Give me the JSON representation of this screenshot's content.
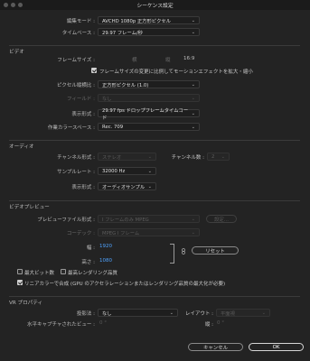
{
  "window": {
    "title": "シーケンス設定"
  },
  "general": {
    "edit_mode_label": "編集モード :",
    "edit_mode_value": "AVCHD 1080p 正方形ピクセル",
    "timebase_label": "タイムベース :",
    "timebase_value": "29.97 フレーム/秒"
  },
  "video": {
    "section_title": "ビデオ",
    "frame_size_label": "フレームサイズ :",
    "frame_size_width": "",
    "horizontal_label": "横",
    "frame_size_height": "",
    "vertical_label": "縦",
    "aspect_ratio": "16:9",
    "scale_checkbox_label": "フレームサイズの変更に比例してモーションエフェクトを拡大・縮小",
    "pixel_aspect_label": "ピクセル縦横比 :",
    "pixel_aspect_value": "正方形ピクセル (1.0)",
    "fields_label": "フィールド :",
    "fields_value": "なし",
    "display_format_label": "表示形式 :",
    "display_format_value": "29.97 fps ドロップフレームタイムコード",
    "working_color_label": "作業カラースペース :",
    "working_color_value": "Rec. 709"
  },
  "audio": {
    "section_title": "オーディオ",
    "channel_format_label": "チャンネル形式 :",
    "channel_format_value": "ステレオ",
    "channels_label": "チャンネル数 :",
    "channels_value": "2",
    "sample_rate_label": "サンプルレート :",
    "sample_rate_value": "32000 Hz",
    "display_format_label": "表示形式 :",
    "display_format_value": "オーディオサンプル"
  },
  "preview": {
    "section_title": "ビデオプレビュー",
    "file_format_label": "プレビューファイル形式 :",
    "file_format_value": "I フレームのみ MPEG",
    "settings_button": "設定...",
    "codec_label": "コーデック :",
    "codec_value": "MPEG I フレーム",
    "width_label": "幅 :",
    "width_value": "1920",
    "height_label": "高さ :",
    "height_value": "1080",
    "reset_button": "リセット",
    "max_bit_depth_label": "最大ビット数",
    "max_render_quality_label": "最高レンダリング品質",
    "linear_color_label": "リニアカラーで合成 (GPU のアクセラレーションまたはレンダリング品質の最大化が必要)"
  },
  "vr": {
    "section_title": "VR プロパティ",
    "projection_label": "投影法 :",
    "projection_value": "なし",
    "layout_label": "レイアウト :",
    "layout_value": "平面視",
    "h_capture_label": "水平キャプチャされたビュー :",
    "h_capture_value": "0 °",
    "vertical_label": "縦 :",
    "vertical_value": "0 °"
  },
  "footer": {
    "cancel_button": "キャンセル",
    "ok_button": "OK"
  }
}
